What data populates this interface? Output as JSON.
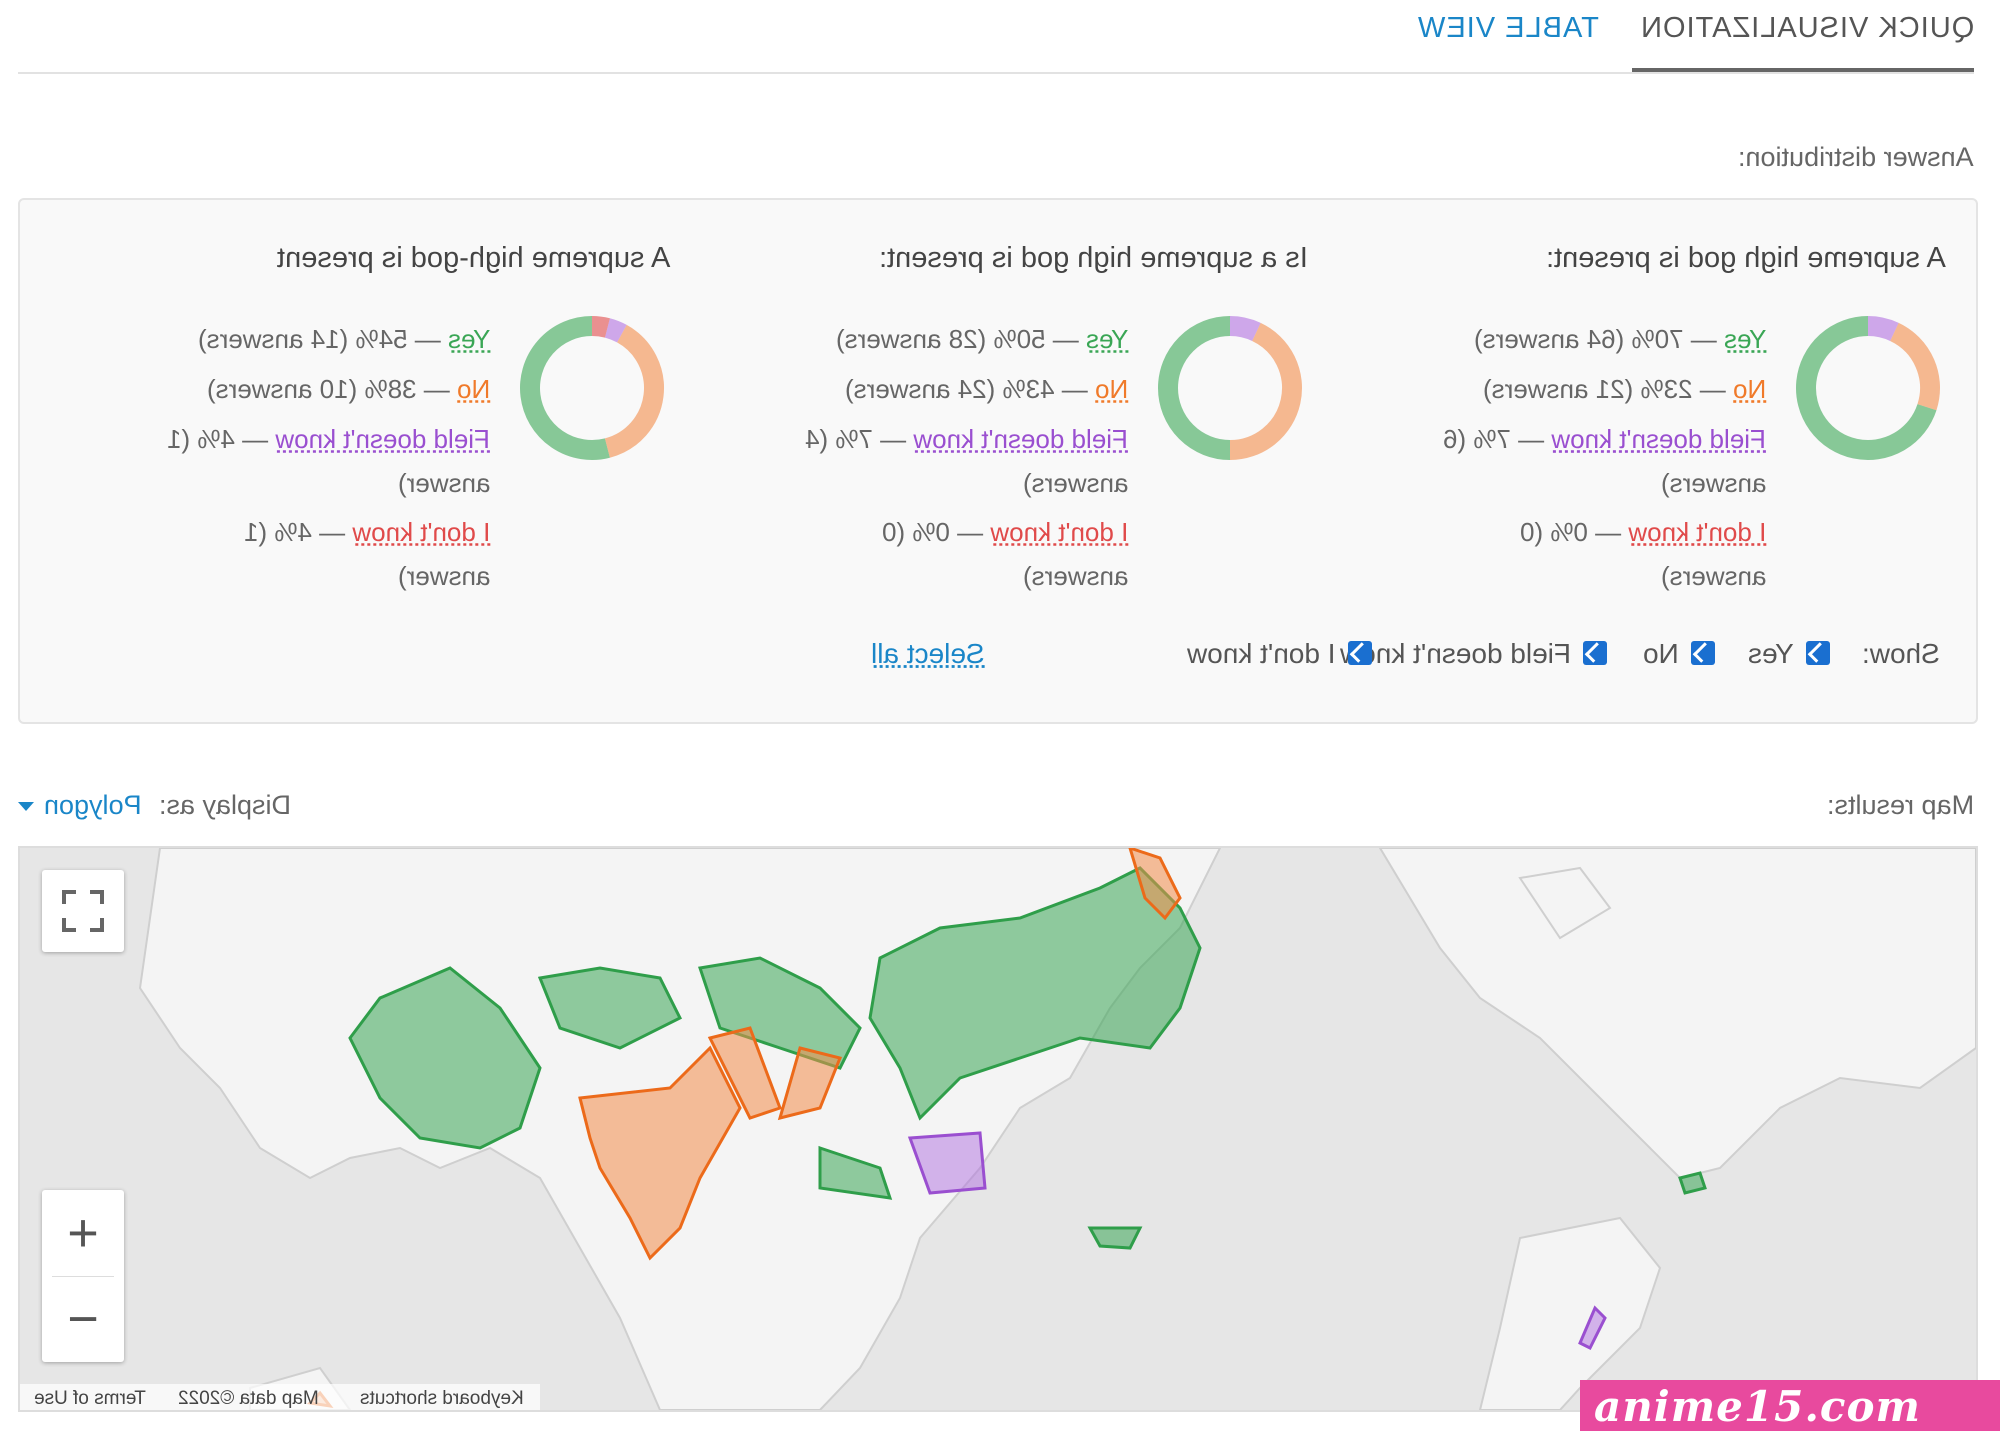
{
  "tabs": {
    "quick": "QUICK VISUALIZATION",
    "table": "TABLE VIEW"
  },
  "distribution": {
    "label": "Answer distribution:",
    "questions": [
      {
        "title": "A supreme high god is present:",
        "legend": [
          {
            "key": "Yes",
            "val": " — 70% (64 answers)"
          },
          {
            "key": "No",
            "val": " — 23% (21 answers)"
          },
          {
            "key": "Field doesn't know",
            "val": " — 7% (6"
          },
          {
            "key": "",
            "val": "answers)"
          },
          {
            "key": "I don't know",
            "val": " — 0% (0"
          },
          {
            "key": "",
            "val": "answers)"
          }
        ],
        "donut": [
          70,
          23,
          7,
          0
        ]
      },
      {
        "title": "Is a supreme high god is present:",
        "legend": [
          {
            "key": "Yes",
            "val": " — 50% (28 answers)"
          },
          {
            "key": "No",
            "val": " — 43% (24 answers)"
          },
          {
            "key": "Field doesn't know",
            "val": " — 7% (4"
          },
          {
            "key": "",
            "val": "answers)"
          },
          {
            "key": "I don't know",
            "val": " — 0% (0"
          },
          {
            "key": "",
            "val": "answers)"
          }
        ],
        "donut": [
          50,
          43,
          7,
          0
        ]
      },
      {
        "title": "A supreme high-god is present",
        "legend": [
          {
            "key": "Yes",
            "val": " — 54% (14 answers)"
          },
          {
            "key": "No",
            "val": " — 38% (10 answers)"
          },
          {
            "key": "Field doesn't know",
            "val": " — 4% (1"
          },
          {
            "key": "",
            "val": "answer)"
          },
          {
            "key": "I don't know",
            "val": " — 4% (1"
          },
          {
            "key": "",
            "val": "answer)"
          }
        ],
        "donut": [
          54,
          38,
          4,
          4
        ]
      }
    ],
    "show": {
      "label": "Show:",
      "options": [
        "Yes",
        "No",
        "Field doesn't know",
        "I don't know"
      ],
      "select_all": "Select all"
    }
  },
  "map_section": {
    "label": "Map results:",
    "display_as_label": "Display as:",
    "display_as_value": "Polygon",
    "attribution": {
      "shortcuts": "Keyboard shortcuts",
      "data": "Map data ©2022",
      "terms": "Terms of Use"
    },
    "colors": {
      "yes": "#3aa655",
      "no": "#f28c4a",
      "field": "#b070e0",
      "idk": "#e04a4a"
    }
  },
  "watermark": "anime15.com"
}
